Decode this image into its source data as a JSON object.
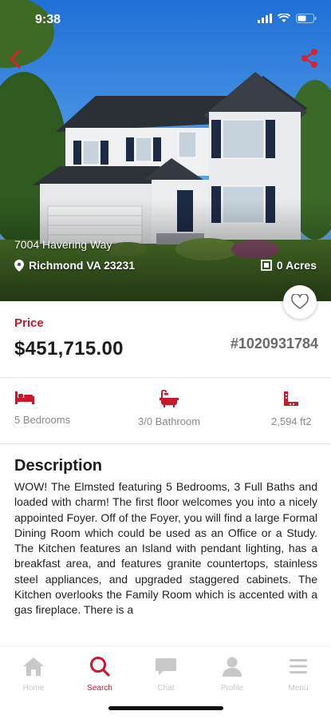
{
  "status_bar": {
    "time": "9:38"
  },
  "listing": {
    "street": "7004 Havering Way",
    "city": "Richmond VA 23231",
    "acres": "0 Acres",
    "price_label": "Price",
    "price": "$451,715.00",
    "mls": "#1020931784"
  },
  "features": [
    {
      "icon": "bed-icon",
      "label": "5 Bedrooms"
    },
    {
      "icon": "bathtub-icon",
      "label": "3/0 Bathroom"
    },
    {
      "icon": "area-icon",
      "label": "2,594 ft2"
    }
  ],
  "description": {
    "title": "Description",
    "body": "WOW!  The Elmsted featuring 5 Bedrooms, 3 Full Baths and loaded with charm!  The first floor welcomes you into a nicely appointed Foyer.  Off of the Foyer, you will find a large Formal Dining Room which could be used as an Office or a Study.   The Kitchen features an Island with pendant lighting, has a breakfast area, and features granite countertops, stainless steel appliances, and upgraded staggered cabinets.  The Kitchen overlooks the Family Room which is accented with a gas fireplace.   There is a"
  },
  "tabs": [
    {
      "label": "Home",
      "icon": "home-icon",
      "active": false
    },
    {
      "label": "Search",
      "icon": "search-icon",
      "active": true
    },
    {
      "label": "Chat",
      "icon": "chat-icon",
      "active": false
    },
    {
      "label": "Profile",
      "icon": "profile-icon",
      "active": false
    },
    {
      "label": "Menu",
      "icon": "menu-icon",
      "active": false
    }
  ],
  "colors": {
    "accent": "#c8182a",
    "inactive_tab": "#c8c8c8",
    "muted_text": "#8a8a8a"
  }
}
